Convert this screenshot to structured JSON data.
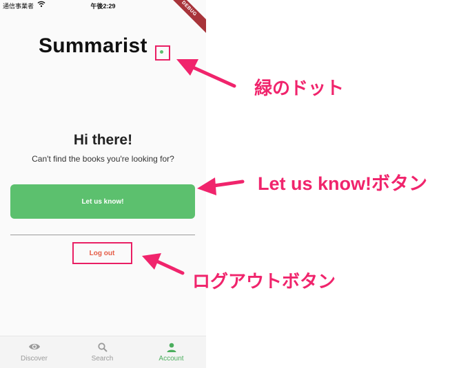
{
  "status_bar": {
    "carrier": "通信事業者",
    "time": "午後2:29"
  },
  "debug_banner": "DEBUG",
  "app": {
    "title": "Summarist"
  },
  "main": {
    "heading": "Hi there!",
    "subtitle": "Can't find the books you're looking for?",
    "letus_label": "Let us know!",
    "logout_label": "Log out"
  },
  "nav": {
    "items": [
      {
        "label": "Discover",
        "icon": "eye-icon"
      },
      {
        "label": "Search",
        "icon": "search-icon"
      },
      {
        "label": "Account",
        "icon": "person-icon",
        "active": true
      }
    ]
  },
  "annotations": {
    "green_dot": "緑のドット",
    "letus_button": "Let us know!ボタン",
    "logout_button": "ログアウトボタン"
  },
  "colors": {
    "accent": "#5cc06e",
    "logout": "#e55b45",
    "annotation": "#f0246c"
  }
}
